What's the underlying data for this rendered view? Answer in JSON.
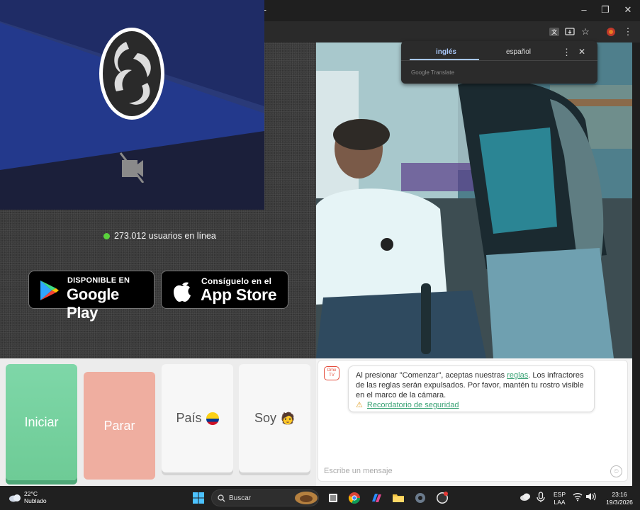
{
  "browser": {
    "new_tab_glyph": "+",
    "window_controls": {
      "minimize": "–",
      "maximize": "❐",
      "close": "✕"
    },
    "toolbar_icons": [
      "translate-icon",
      "install-app-icon",
      "bookmark-star-icon",
      "extension-icon",
      "menu-icon"
    ]
  },
  "translate_popup": {
    "source_language": "inglés",
    "target_language": "español",
    "provider": "Google Translate",
    "menu_glyph": "⋮",
    "close_glyph": "✕"
  },
  "stats": {
    "online_text": "273.012 usuarios en línea"
  },
  "stores": {
    "google": {
      "small": "DISPONIBLE EN",
      "big": "Google Play"
    },
    "apple": {
      "small": "Consíguelo en el",
      "big": "App Store"
    }
  },
  "controls": {
    "start": "Iniciar",
    "stop": "Parar",
    "country": "País",
    "gender": "Soy",
    "gender_emoji": "🧑"
  },
  "chat": {
    "badge": "Ome TV",
    "notice_before_link": "Al presionar \"Comenzar\", aceptas nuestras ",
    "rules_link": "reglas",
    "notice_after_link": ". Los infractores de las reglas serán expulsados. Por favor, mantén tu rostro visible en el marco de la cámara.",
    "safety_link": "Recordatorio de seguridad",
    "input_placeholder": "Escribe un mensaje",
    "emoji_glyph": "☺"
  },
  "taskbar": {
    "weather_temp": "22°C",
    "weather_desc": "Nublado",
    "search_label": "Buscar",
    "language": "ESP",
    "layout": "LAA",
    "time": "23:16",
    "date": "19/3/2026"
  }
}
